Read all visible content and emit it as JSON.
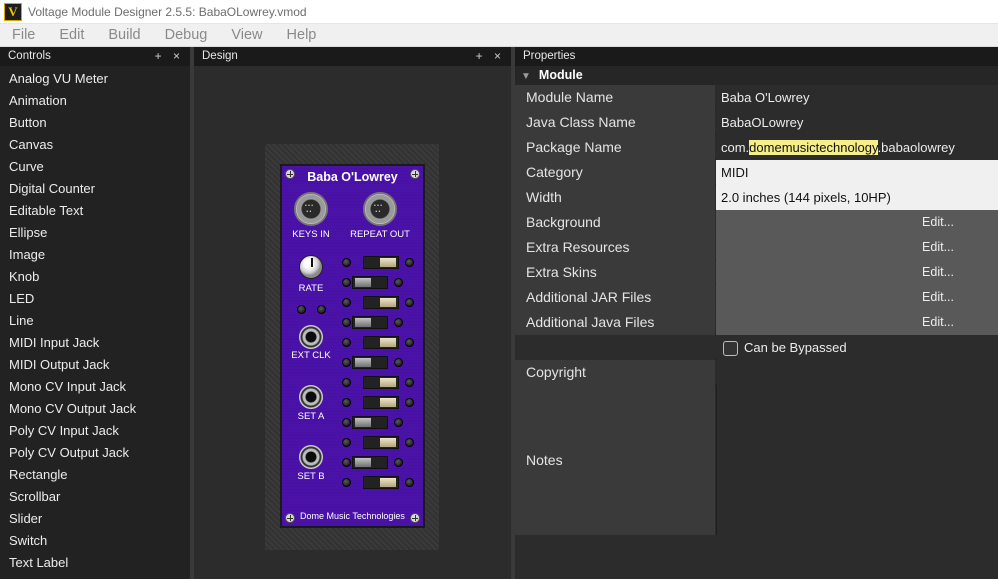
{
  "window": {
    "title": "Voltage Module Designer 2.5.5: BabaOLowrey.vmod",
    "icon_letter": "V"
  },
  "menu": [
    "File",
    "Edit",
    "Build",
    "Debug",
    "View",
    "Help"
  ],
  "controls_panel": {
    "title": "Controls",
    "controls_icons": "+ ×",
    "items": [
      "Analog VU Meter",
      "Animation",
      "Button",
      "Canvas",
      "Curve",
      "Digital Counter",
      "Editable Text",
      "Ellipse",
      "Image",
      "Knob",
      "LED",
      "Line",
      "MIDI Input Jack",
      "MIDI Output Jack",
      "Mono CV Input Jack",
      "Mono CV Output Jack",
      "Poly CV Input Jack",
      "Poly CV Output Jack",
      "Rectangle",
      "Scrollbar",
      "Slider",
      "Switch",
      "Text Label"
    ]
  },
  "design_panel": {
    "title": "Design",
    "controls_icons": "+ ×",
    "module": {
      "title": "Baba O'Lowrey",
      "footer": "Dome Music Technologies",
      "labels": {
        "keys_in": "KEYS IN",
        "repeat_out": "REPEAT OUT",
        "rate": "RATE",
        "ext_clk": "EXT CLK",
        "set_a": "SET A",
        "set_b": "SET B"
      },
      "accent_color": "#4a12a8"
    }
  },
  "properties_panel": {
    "title": "Properties",
    "section": "Module",
    "rows": {
      "module_name": {
        "label": "Module Name",
        "value": "Baba O'Lowrey"
      },
      "java_class_name": {
        "label": "Java Class Name",
        "value": "BabaOLowrey"
      },
      "package_name": {
        "label": "Package Name",
        "value_prefix": "com.",
        "value_highlight": "domemusictechnology",
        "value_suffix": ".babaolowrey"
      },
      "category": {
        "label": "Category",
        "value": "MIDI"
      },
      "width": {
        "label": "Width",
        "value": "2.0 inches (144 pixels, 10HP)"
      },
      "background": {
        "label": "Background",
        "value": "Edit..."
      },
      "extra_resources": {
        "label": "Extra Resources",
        "value": "Edit..."
      },
      "extra_skins": {
        "label": "Extra Skins",
        "value": "Edit..."
      },
      "additional_jar_files": {
        "label": "Additional JAR Files",
        "value": "Edit..."
      },
      "additional_java_files": {
        "label": "Additional Java Files",
        "value": "Edit..."
      },
      "can_be_bypassed": {
        "label": "Can be Bypassed",
        "checked": false
      },
      "copyright": {
        "label": "Copyright",
        "value": ""
      },
      "notes": {
        "label": "Notes",
        "value": ""
      }
    }
  }
}
